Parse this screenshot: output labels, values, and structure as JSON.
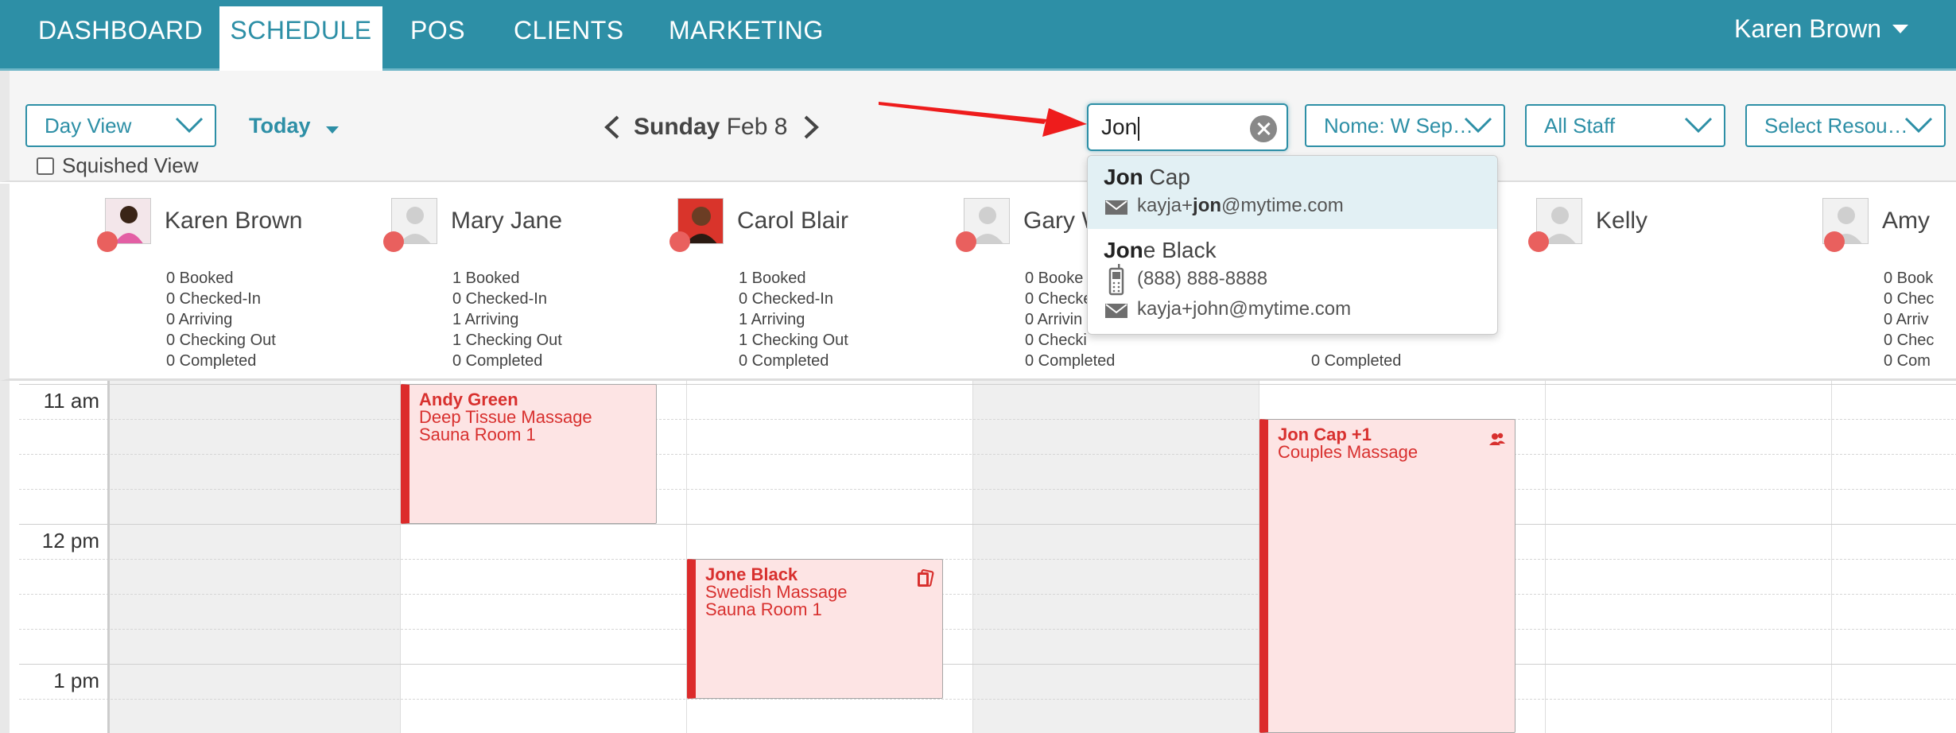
{
  "nav": {
    "items": [
      {
        "label": "DASHBOARD"
      },
      {
        "label": "SCHEDULE",
        "active": true
      },
      {
        "label": "POS"
      },
      {
        "label": "CLIENTS"
      },
      {
        "label": "MARKETING"
      }
    ],
    "user": "Karen Brown"
  },
  "toolbar": {
    "view_select": "Day View",
    "today": "Today",
    "date_day": "Sunday",
    "date_rest": "Feb 8",
    "squished_view": "Squished View",
    "search_value": "Jon",
    "location_select": "Nome: W Sep…",
    "staff_select": "All Staff",
    "resource_select": "Select Resou…"
  },
  "search_results": [
    {
      "name_match": "Jon",
      "name_rest": " Cap",
      "email_pre": "kayja+",
      "email_match": "jon",
      "email_post": "@mytime.com"
    },
    {
      "name_match": "Jon",
      "name_rest": "e Black",
      "phone": "(888) 888-8888",
      "email": "kayja+john@mytime.com"
    }
  ],
  "staff": [
    {
      "name": "Karen Brown",
      "booked": "0 Booked",
      "checked_in": "0 Checked-In",
      "arriving": "0 Arriving",
      "checking_out": "0 Checking Out",
      "completed": "0 Completed"
    },
    {
      "name": "Mary Jane",
      "booked": "1 Booked",
      "checked_in": "0 Checked-In",
      "arriving": "1 Arriving",
      "checking_out": "1 Checking Out",
      "completed": "0 Completed"
    },
    {
      "name": "Carol Blair",
      "booked": "1 Booked",
      "checked_in": "0 Checked-In",
      "arriving": "1 Arriving",
      "checking_out": "1 Checking Out",
      "completed": "0 Completed"
    },
    {
      "name": "Gary W",
      "booked": "0 Booke",
      "checked_in": "0 Checke",
      "arriving": "0 Arrivin",
      "checking_out": "0 Checki",
      "completed": "0 Completed"
    },
    {
      "name": "",
      "booked": "",
      "checked_in": "",
      "arriving": "",
      "checking_out": "",
      "completed": "0 Completed"
    },
    {
      "name": "Kelly",
      "booked": "",
      "checked_in": "",
      "arriving": "",
      "checking_out": "",
      "completed": ""
    },
    {
      "name": "Amy",
      "booked": "0 Book",
      "checked_in": "0 Chec",
      "arriving": "0 Arriv",
      "checking_out": "0 Chec",
      "completed": "0 Com"
    }
  ],
  "times": [
    "11 am",
    "12 pm",
    "1 pm"
  ],
  "appointments": [
    {
      "client": "Andy Green",
      "service": "Deep Tissue Massage",
      "room": "Sauna Room 1"
    },
    {
      "client": "Jone Black",
      "service": "Swedish Massage",
      "room": "Sauna Room 1",
      "icon": "cards-icon"
    },
    {
      "client": "Jon Cap +1",
      "service": "Couples Massage",
      "room": "",
      "icon": "group-icon"
    }
  ],
  "colors": {
    "brand": "#2d8fa6",
    "appointment_bg": "#fde4e4",
    "appointment_accent": "#dc2b2b",
    "status_dot": "#e9605e",
    "annotation_arrow": "#ee1c1c"
  }
}
